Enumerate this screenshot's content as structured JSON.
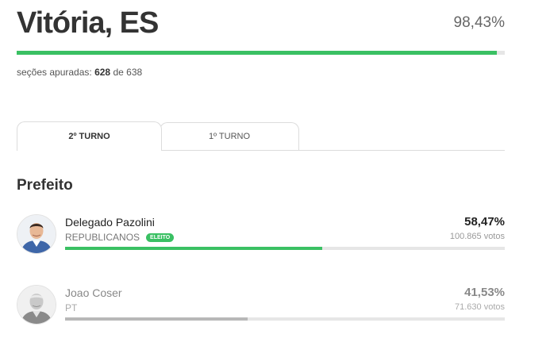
{
  "header": {
    "city": "Vitória, ES",
    "percent_counted": "98,43%",
    "progress": 0.9843,
    "sections_label": "seções apuradas:",
    "sections_counted": "628",
    "sections_of": "de",
    "sections_total": "638"
  },
  "tabs": [
    {
      "label": "2º TURNO",
      "active": true
    },
    {
      "label": "1º TURNO",
      "active": false
    }
  ],
  "office": "Prefeito",
  "candidates": [
    {
      "name": "Delegado Pazolini",
      "party": "REPUBLICANOS",
      "badge": "ELEITO",
      "percent": "58,47%",
      "votes": "100.865 votos",
      "share": 0.5847,
      "bar_color": "#3ac063"
    },
    {
      "name": "Joao Coser",
      "party": "PT",
      "percent": "41,53%",
      "votes": "71.630 votos",
      "share": 0.4153,
      "bar_color": "#b8b8b8"
    }
  ],
  "colors": {
    "accent": "#3ac063"
  }
}
